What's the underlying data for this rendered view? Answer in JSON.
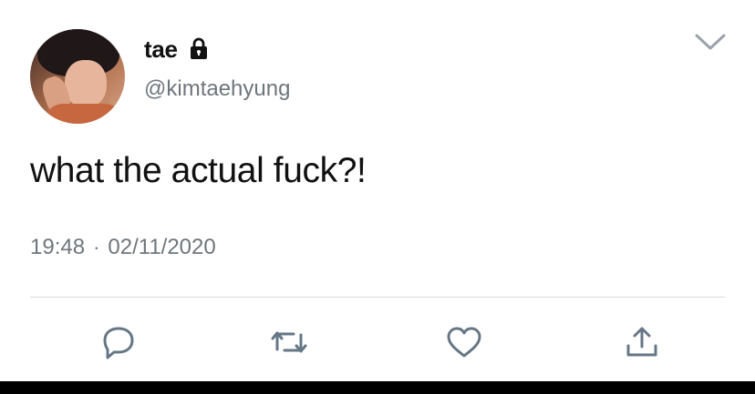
{
  "tweet": {
    "display_name": "tae",
    "handle": "@kimtaehyung",
    "text": "what the actual fuck?!",
    "time": "19:48",
    "separator": "·",
    "date": "02/11/2020"
  },
  "icons": {
    "protected": "lock-icon",
    "more": "chevron-down-icon",
    "reply": "reply-icon",
    "retweet": "retweet-icon",
    "like": "heart-icon",
    "share": "share-icon"
  },
  "colors": {
    "text_primary": "#111111",
    "text_secondary": "#6e767d",
    "icon_gray": "#657786",
    "divider": "#d7dbdf"
  }
}
